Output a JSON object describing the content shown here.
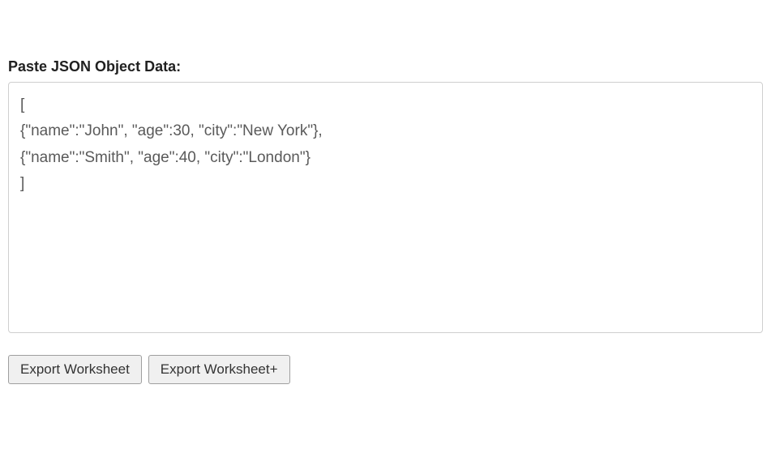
{
  "form": {
    "label": "Paste JSON Object Data:",
    "textarea_value": "[\n{\"name\":\"John\", \"age\":30, \"city\":\"New York\"},\n{\"name\":\"Smith\", \"age\":40, \"city\":\"London\"}\n]"
  },
  "buttons": {
    "export_worksheet": "Export Worksheet",
    "export_worksheet_plus": "Export Worksheet+"
  }
}
